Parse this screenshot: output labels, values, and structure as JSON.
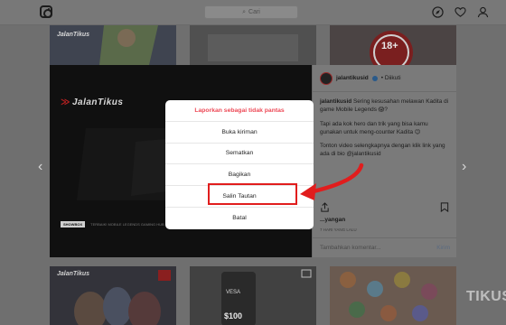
{
  "search": {
    "placeholder": "Cari"
  },
  "post": {
    "brand": "JalanTikus",
    "strip_tag": "SHOWBOX",
    "strip_text": "TERBAIK! MOBILE LEGENDS GAMING HUB",
    "username": "jalantikusid",
    "follow_status": "• Diikuti",
    "caption": [
      {
        "user": "jalantikusid",
        "text": "Sering kesusahan melawan Kadita di game Mobile Legends 😱?"
      },
      {
        "user": "",
        "text": "Tapi ada kok hero dan trik yang bisa kamu gunakan untuk meng-counter Kadita 😉"
      },
      {
        "user": "",
        "text": "Tonton video selengkapnya dengan klik link yang ada di bio @jalantikusid"
      }
    ],
    "likes": "...yangan",
    "time_ago": "7 HARI YANG LALU",
    "comment_placeholder": "Tambahkan komentar...",
    "comment_post": "Kirim"
  },
  "modal": {
    "items": [
      {
        "label": "Laporkan sebagai tidak pantas",
        "style": "danger"
      },
      {
        "label": "Buka kiriman",
        "style": ""
      },
      {
        "label": "Sematkan",
        "style": ""
      },
      {
        "label": "Bagikan",
        "style": ""
      },
      {
        "label": "Salin Tautan",
        "style": ""
      },
      {
        "label": "Batal",
        "style": ""
      }
    ]
  },
  "tiles": {
    "top_right_badge": "18+",
    "bottom_left_brand": "JalanTikus",
    "bottom_mid_text": "VESA",
    "bottom_mid_price": "$100"
  },
  "watermark": "TIKUS",
  "colors": {
    "danger": "#ed4956",
    "highlight": "#e11d1d"
  }
}
